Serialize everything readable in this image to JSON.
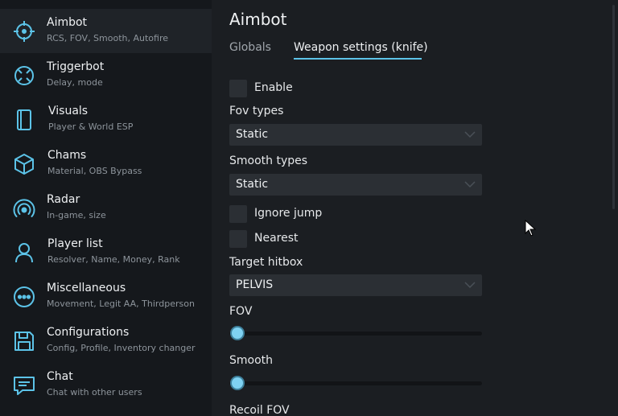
{
  "sidebar": {
    "items": [
      {
        "title": "Aimbot",
        "subtitle": "RCS, FOV, Smooth, Autofire",
        "icon": "crosshair-icon"
      },
      {
        "title": "Triggerbot",
        "subtitle": "Delay, mode",
        "icon": "target-icon"
      },
      {
        "title": "Visuals",
        "subtitle": "Player & World ESP",
        "icon": "panel-icon"
      },
      {
        "title": "Chams",
        "subtitle": "Material, OBS Bypass",
        "icon": "cube-icon"
      },
      {
        "title": "Radar",
        "subtitle": "In-game, size",
        "icon": "radar-icon"
      },
      {
        "title": "Player list",
        "subtitle": "Resolver, Name, Money, Rank",
        "icon": "user-icon"
      },
      {
        "title": "Miscellaneous",
        "subtitle": "Movement, Legit AA, Thirdperson",
        "icon": "more-icon"
      },
      {
        "title": "Configurations",
        "subtitle": "Config, Profile, Inventory changer",
        "icon": "save-icon"
      },
      {
        "title": "Chat",
        "subtitle": "Chat with other users",
        "icon": "chat-icon"
      }
    ]
  },
  "main": {
    "title": "Aimbot",
    "tabs": [
      {
        "label": "Globals"
      },
      {
        "label": "Weapon settings (knife)"
      }
    ],
    "enable_label": "Enable",
    "fov_types_label": "Fov types",
    "fov_types_value": "Static",
    "smooth_types_label": "Smooth types",
    "smooth_types_value": "Static",
    "ignore_jump_label": "Ignore jump",
    "nearest_label": "Nearest",
    "target_hitbox_label": "Target hitbox",
    "target_hitbox_value": "PELVIS",
    "fov_label": "FOV",
    "fov_value": 0,
    "smooth_label": "Smooth",
    "smooth_value": 0,
    "recoil_fov_label": "Recoil FOV"
  },
  "colors": {
    "accent": "#5cc3e8",
    "sidebar_bg": "#15181c",
    "main_bg": "#1b1e22",
    "control_bg": "#2b2f34"
  }
}
